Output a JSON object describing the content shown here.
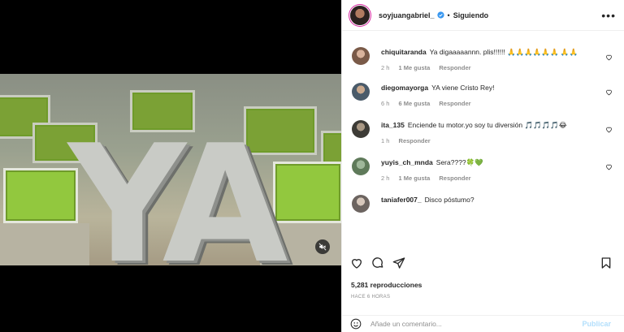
{
  "header": {
    "username": "soyjuangabriel_",
    "separator": "•",
    "follow_state": "Siguiendo",
    "more_glyph": "•••"
  },
  "media": {
    "overlay_text": "YA",
    "muted": true
  },
  "comments": [
    {
      "username": "chiquitaranda",
      "text": "Ya digaaaaannn. plis!!!!!! 🙏🙏🙏🙏🙏🙏 🙏🙏",
      "time": "2 h",
      "likes": "1 Me gusta",
      "reply": "Responder",
      "avatar_color": "#7a5a48"
    },
    {
      "username": "diegomayorga",
      "text": "YA viene Cristo Rey!",
      "time": "6 h",
      "likes": "6 Me gusta",
      "reply": "Responder",
      "avatar_color": "#4a5b6a"
    },
    {
      "username": "ita_135",
      "text": "Enciende tu motor.yo soy tu diversión 🎵🎵🎵🎵😂",
      "time": "1 h",
      "likes": "",
      "reply": "Responder",
      "avatar_color": "#3d3b36"
    },
    {
      "username": "yuyis_ch_mnda",
      "text": "Sera????🍀💚",
      "time": "2 h",
      "likes": "1 Me gusta",
      "reply": "Responder",
      "avatar_color": "#5f7a5a"
    },
    {
      "username": "taniafer007_",
      "text": "Disco póstumo?",
      "time": "",
      "likes": "",
      "reply": "",
      "avatar_color": "#6c6460"
    }
  ],
  "stats": {
    "views": "5,281 reproducciones",
    "age": "HACE 6 HORAS"
  },
  "composer": {
    "placeholder": "Añade un comentario...",
    "post_label": "Publicar"
  },
  "colors": {
    "accent_disabled": "#b2dffc",
    "verified": "#3897f0",
    "muted_text": "#8e8e8e"
  }
}
